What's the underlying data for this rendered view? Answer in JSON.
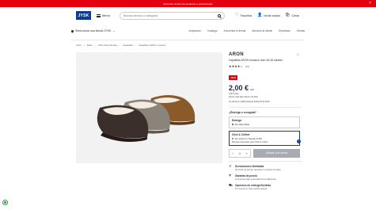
{
  "promo": {
    "text": "Descubre cientos de productos a precios bajos",
    "close_icon": "close-icon"
  },
  "header": {
    "logo": "JYSK",
    "menu_label": "Menú",
    "search_placeholder": "Buscar artículo o categoría",
    "favorites": "Favoritos",
    "login": "Iniciar sesión",
    "cart": "Cesta"
  },
  "subbar": {
    "store": "Selecciona una tienda JYSK",
    "links": [
      "Inspiración",
      "Catálogo",
      "Encuentra tu tienda",
      "Atención al cliente",
      "Empresas",
      "Ofertas"
    ]
  },
  "breadcrumb": [
    "Inicio",
    "Baño",
    "Alfombras/Textiles",
    "Zapatillas",
    "Zapatillas ARON mocasín"
  ],
  "product": {
    "brand": "ARON",
    "subtitle": "Zapatillas ARON mocasín núm 36-45 variado",
    "stars": "★★★★☆",
    "reviews": "(27)",
    "badge": "-50%",
    "price": "2,00 €",
    "price_unit": "/par",
    "old_price": "4,00 € /par",
    "price_note": "Precio más bajo últimos 30 días",
    "validity": "La oferta es válida hasta la fecha 09.11.2024",
    "delivery_question": "¿Entrega o recogida?",
    "delivery_title": "Entrega",
    "delivery_status": "No disponible",
    "delivery_status_color": "#e3000f",
    "cc_title": "Click & Collect",
    "cc_store_line": "En stock en Tienda JYSK",
    "cc_note": "Recoger disponible para Click & Collect",
    "cc_status_color": "#3a9a4a",
    "qty": "1",
    "add_button": "Añadir a la cesta"
  },
  "features": [
    {
      "icon": "return-icon",
      "title": "Devoluciones ilimitadas",
      "desc": "Sin límite de tiempo: devuelve tu compra sin ticket"
    },
    {
      "icon": "shield-icon",
      "title": "Garantía de precio",
      "desc": "Si el precio baja, te devolvemos la diferencia"
    },
    {
      "icon": "truck-icon",
      "title": "Opciones de entrega flexibles",
      "desc": "Tu compra en casa cuando quieras"
    }
  ]
}
